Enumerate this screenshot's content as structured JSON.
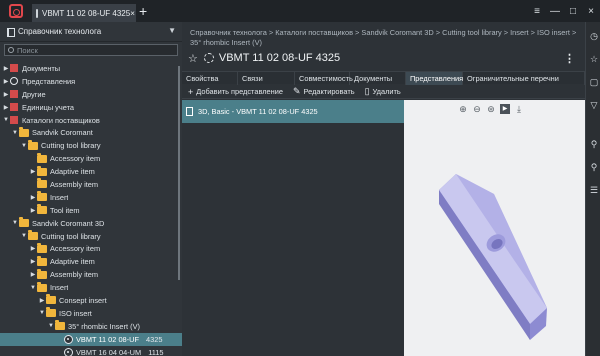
{
  "tab": {
    "title": "VBMT 11 02 08-UF   4325",
    "close": "×",
    "new": "+"
  },
  "window": {
    "menu": "≡",
    "minimize": "—",
    "maximize": "□",
    "close": "×"
  },
  "left_panel": {
    "title": "Справочник технолога",
    "search_placeholder": "Поиск",
    "tree": [
      {
        "label": "Документы",
        "extra": "",
        "icon": "redbook",
        "arrow": "▶",
        "indent": 0,
        "selected": false
      },
      {
        "label": "Представления",
        "extra": "",
        "icon": "gearring",
        "arrow": "▶",
        "indent": 0,
        "selected": false
      },
      {
        "label": "Другие",
        "extra": "",
        "icon": "redbook",
        "arrow": "▶",
        "indent": 0,
        "selected": false
      },
      {
        "label": "Единицы учета",
        "extra": "",
        "icon": "redbook",
        "arrow": "▶",
        "indent": 0,
        "selected": false
      },
      {
        "label": "Каталоги поставщиков",
        "extra": "",
        "icon": "redbook",
        "arrow": "▼",
        "indent": 0,
        "selected": false
      },
      {
        "label": "Sandvik Coromant",
        "extra": "",
        "icon": "folder",
        "arrow": "▼",
        "indent": 1,
        "selected": false
      },
      {
        "label": "Cutting tool library",
        "extra": "",
        "icon": "folder",
        "arrow": "▼",
        "indent": 2,
        "selected": false
      },
      {
        "label": "Accessory item",
        "extra": "",
        "icon": "folder",
        "arrow": "",
        "indent": 3,
        "selected": false
      },
      {
        "label": "Adaptive item",
        "extra": "",
        "icon": "folder",
        "arrow": "▶",
        "indent": 3,
        "selected": false
      },
      {
        "label": "Assembly item",
        "extra": "",
        "icon": "folder",
        "arrow": "",
        "indent": 3,
        "selected": false
      },
      {
        "label": "Insert",
        "extra": "",
        "icon": "folder",
        "arrow": "▶",
        "indent": 3,
        "selected": false
      },
      {
        "label": "Tool item",
        "extra": "",
        "icon": "folder",
        "arrow": "▶",
        "indent": 3,
        "selected": false
      },
      {
        "label": "Sandvik Coromant 3D",
        "extra": "",
        "icon": "folder",
        "arrow": "▼",
        "indent": 1,
        "selected": false
      },
      {
        "label": "Cutting tool library",
        "extra": "",
        "icon": "folder",
        "arrow": "▼",
        "indent": 2,
        "selected": false
      },
      {
        "label": "Accessory item",
        "extra": "",
        "icon": "folder",
        "arrow": "▶",
        "indent": 3,
        "selected": false
      },
      {
        "label": "Adaptive item",
        "extra": "",
        "icon": "folder",
        "arrow": "▶",
        "indent": 3,
        "selected": false
      },
      {
        "label": "Assembly item",
        "extra": "",
        "icon": "folder",
        "arrow": "▶",
        "indent": 3,
        "selected": false
      },
      {
        "label": "Insert",
        "extra": "",
        "icon": "folder",
        "arrow": "▼",
        "indent": 3,
        "selected": false
      },
      {
        "label": "Consept insert",
        "extra": "",
        "icon": "folder",
        "arrow": "▶",
        "indent": 4,
        "selected": false
      },
      {
        "label": "ISO insert",
        "extra": "",
        "icon": "folder",
        "arrow": "▼",
        "indent": 4,
        "selected": false
      },
      {
        "label": "35° rhombic  Insert (V)",
        "extra": "",
        "icon": "folder",
        "arrow": "▼",
        "indent": 5,
        "selected": false
      },
      {
        "label": "VBMT 11 02 08-UF",
        "extra": "4325",
        "icon": "eyedoc",
        "arrow": "",
        "indent": 6,
        "selected": true
      },
      {
        "label": "VBMT 16 04 04-UM",
        "extra": "1115",
        "icon": "eyedoc",
        "arrow": "",
        "indent": 6,
        "selected": false
      }
    ]
  },
  "main": {
    "breadcrumb": "Справочник технолога > Каталоги поставщиков > Sandvik Coromant 3D > Cutting tool library > Insert > ISO insert > 35° rhombic  Insert (V)",
    "title": "VBMT 11 02 08-UF   4325",
    "more": "⋮",
    "tabs": [
      {
        "label": "Свойства",
        "active": false
      },
      {
        "label": "Связи",
        "active": false
      },
      {
        "label": "Совместимость",
        "active": false
      },
      {
        "label": "Документы",
        "active": false
      },
      {
        "label": "Представления",
        "active": true
      },
      {
        "label": "Ограничительные перечни",
        "active": false
      }
    ],
    "toolbar": {
      "add": "Добавить представление",
      "edit": "Редактировать",
      "delete": "Удалить"
    },
    "list": [
      {
        "label": "3D, Basic - VBMT 11 02 08-UF   4325"
      }
    ]
  },
  "icons": {
    "viewer": [
      "zoom-in-icon",
      "zoom-out-icon",
      "zoom-fit-icon",
      "play-icon",
      "download-icon"
    ],
    "right_strip": [
      "history-icon",
      "star-icon",
      "box-icon",
      "filter-icon",
      "search-icon",
      "search-advanced-icon",
      "list-icon"
    ]
  },
  "colors": {
    "selection": "#4b7f8a",
    "insert_light": "#c9c8ef",
    "insert_mid": "#a8a6e2",
    "insert_dark": "#8a88cf"
  }
}
